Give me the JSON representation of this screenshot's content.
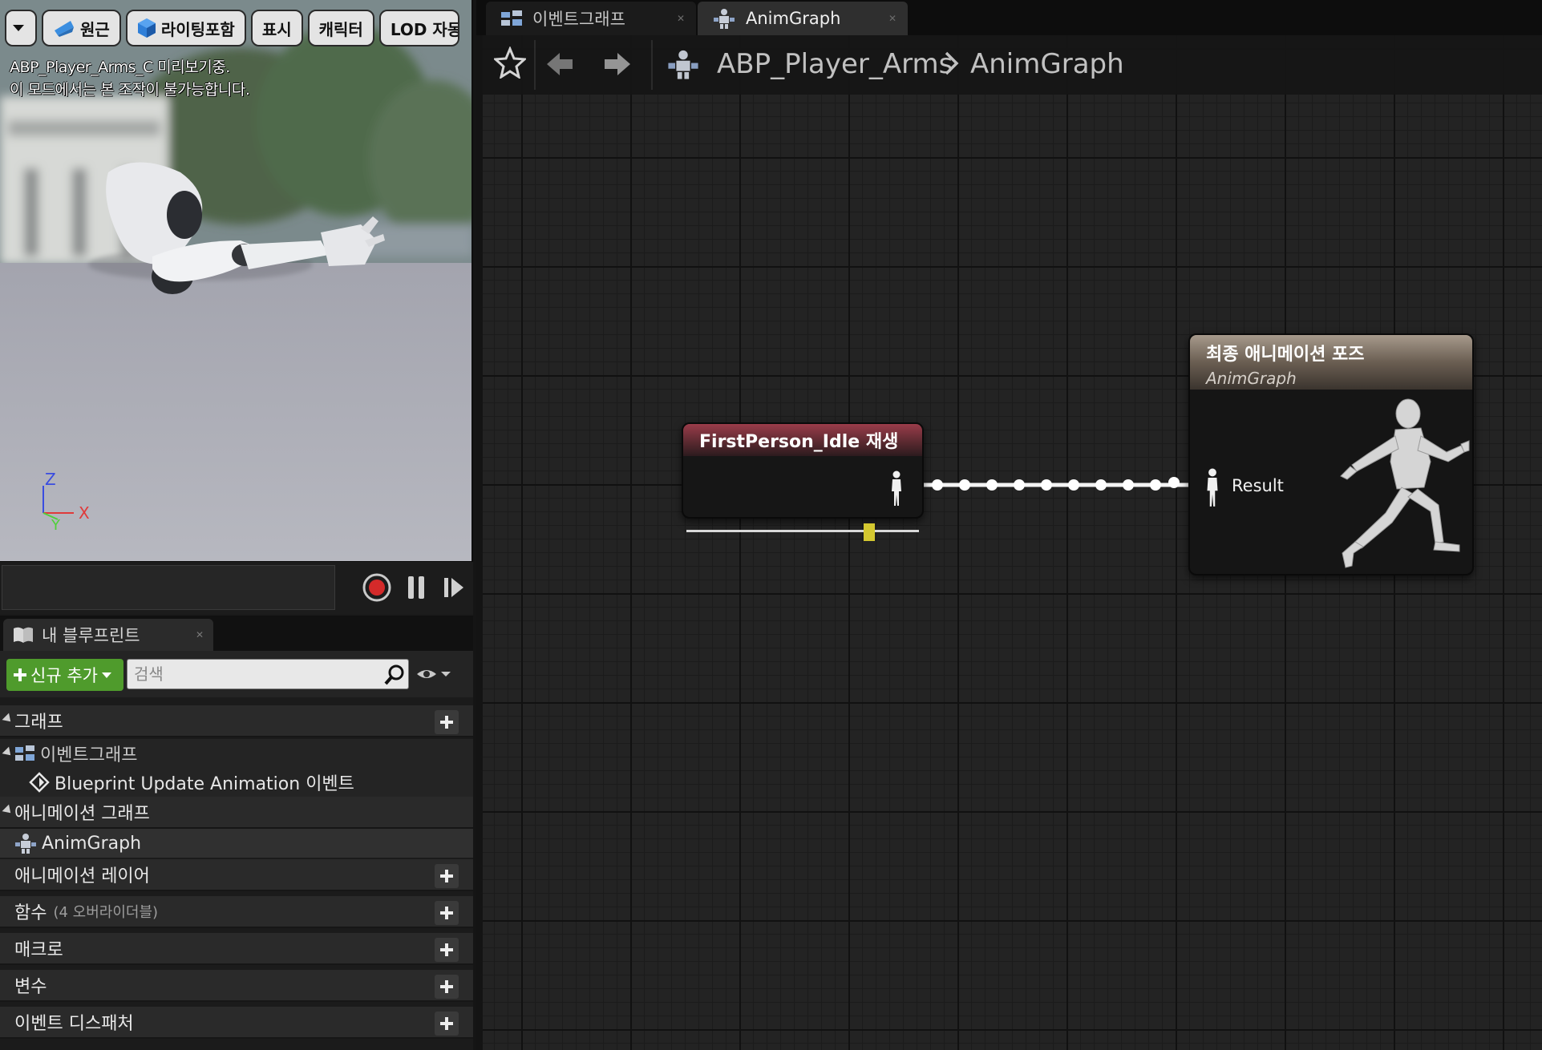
{
  "viewport": {
    "toolbar": {
      "menu_label": "",
      "perspective_label": "원근",
      "lighting_label": "라이팅포함",
      "show_label": "표시",
      "character_label": "캐릭터",
      "lod_label": "LOD 자동"
    },
    "info_line1": "ABP_Player_Arms_C 미리보기중.",
    "info_line2": "이 모드에서는 본 조작이 불가능합니다.",
    "axis": {
      "z": "Z",
      "y": "Y",
      "x": "X"
    }
  },
  "my_blueprint": {
    "tab_title": "내 블루프린트",
    "add_new_label": "신규 추가",
    "search_placeholder": "검색",
    "sections": {
      "graphs": "그래프",
      "event_graph": "이벤트그래프",
      "blueprint_update": "Blueprint Update Animation 이벤트",
      "anim_graphs": "애니메이션 그래프",
      "anim_graph_item": "AnimGraph",
      "anim_layers": "애니메이션 레이어",
      "functions": "함수",
      "functions_note": "(4 오버라이더블)",
      "macros": "매크로",
      "variables": "변수",
      "dispatchers": "이벤트 디스패처"
    }
  },
  "tabs": {
    "event_graph": "이벤트그래프",
    "anim_graph": "AnimGraph"
  },
  "breadcrumb": {
    "blueprint": "ABP_Player_Arms",
    "graph": "AnimGraph"
  },
  "nodes": {
    "play_node_title": "FirstPerson_Idle 재생",
    "play_position": 0.8,
    "result_title": "최종 애니메이션 포즈",
    "result_subtitle": "AnimGraph",
    "result_pin": "Result"
  },
  "colors": {
    "accent_green": "#4f9b2c",
    "play_header": "#9a3c4a",
    "result_header": "#a79a8c",
    "slider_thumb": "#d4c830",
    "record": "#d42a2a"
  }
}
